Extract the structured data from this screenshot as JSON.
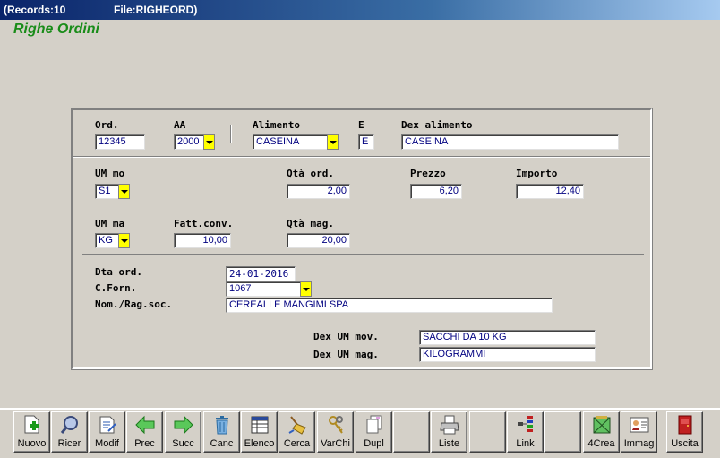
{
  "window": {
    "records": "(Records:10",
    "file": "File:RIGHEORD)"
  },
  "page_title": "Righe Ordini",
  "section1": {
    "ord_label": "Ord.",
    "ord_value": "12345",
    "aa_label": "AA",
    "aa_value": "2000",
    "alimento_label": "Alimento",
    "alimento_value": "CASEINA",
    "e_label": "E",
    "e_value": "E",
    "dex_alimento_label": "Dex alimento",
    "dex_alimento_value": "CASEINA"
  },
  "section2": {
    "um_mo_label": "UM mo",
    "um_mo_value": "S1",
    "qta_ord_label": "Qtà ord.",
    "qta_ord_value": "2,00",
    "prezzo_label": "Prezzo",
    "prezzo_value": "6,20",
    "importo_label": "Importo",
    "importo_value": "12,40",
    "um_ma_label": "UM ma",
    "um_ma_value": "KG",
    "fatt_conv_label": "Fatt.conv.",
    "fatt_conv_value": "10,00",
    "qta_mag_label": "Qtà mag.",
    "qta_mag_value": "20,00"
  },
  "section3": {
    "dta_ord_label": "Dta ord.",
    "dta_ord_value": "24-01-2016",
    "c_forn_label": "C.Forn.",
    "c_forn_value": "1067",
    "nom_label": "Nom./Rag.soc.",
    "nom_value": "CEREALI E MANGIMI SPA",
    "dex_um_mov_label": "Dex UM mov.",
    "dex_um_mov_value": "SACCHI DA 10 KG",
    "dex_um_mag_label": "Dex UM mag.",
    "dex_um_mag_value": "KILOGRAMMI"
  },
  "toolbar": [
    {
      "label": "Nuovo",
      "icon": "new-document-icon"
    },
    {
      "label": "Ricer",
      "icon": "search-icon"
    },
    {
      "label": "Modif",
      "icon": "edit-icon"
    },
    {
      "label": "Prec",
      "icon": "arrow-left-icon"
    },
    {
      "label": "Succ",
      "icon": "arrow-right-icon"
    },
    {
      "label": "Canc",
      "icon": "trash-icon"
    },
    {
      "label": "Elenco",
      "icon": "list-icon"
    },
    {
      "label": "Cerca",
      "icon": "broom-icon"
    },
    {
      "label": "VarChi",
      "icon": "keys-icon"
    },
    {
      "label": "Dupl",
      "icon": "duplicate-icon"
    },
    {
      "label": "",
      "icon": ""
    },
    {
      "label": "Liste",
      "icon": "printer-icon"
    },
    {
      "label": "",
      "icon": ""
    },
    {
      "label": "Link",
      "icon": "link-icon"
    },
    {
      "label": "",
      "icon": ""
    },
    {
      "label": "4Crea",
      "icon": "create-icon"
    },
    {
      "label": "Immag",
      "icon": "image-card-icon"
    },
    {
      "label": "",
      "icon": ""
    },
    {
      "label": "Uscita",
      "icon": "exit-door-icon"
    }
  ],
  "colors": {
    "title_green": "#198c19",
    "field_text": "#000080",
    "dropdown_yellow": "#ffff00"
  }
}
